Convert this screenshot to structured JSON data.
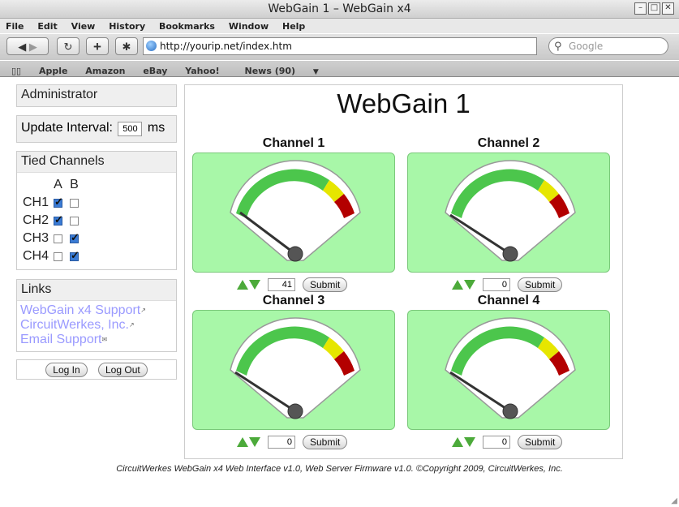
{
  "window": {
    "title": "WebGain 1 – WebGain x4"
  },
  "menu": [
    "File",
    "Edit",
    "View",
    "History",
    "Bookmarks",
    "Window",
    "Help"
  ],
  "toolbar": {
    "url": "http://yourip.net/index.htm",
    "search_placeholder": "Google"
  },
  "bookmarks": [
    "Apple",
    "Amazon",
    "eBay",
    "Yahoo!",
    "News (90)"
  ],
  "sidebar": {
    "admin_label": "Administrator",
    "interval_label": "Update Interval:",
    "interval_value": "500",
    "interval_unit": "ms",
    "tied_title": "Tied Channels",
    "col_a": "A",
    "col_b": "B",
    "tied": [
      {
        "label": "CH1",
        "a": true,
        "b": false
      },
      {
        "label": "CH2",
        "a": true,
        "b": false
      },
      {
        "label": "CH3",
        "a": false,
        "b": true
      },
      {
        "label": "CH4",
        "a": false,
        "b": true
      }
    ],
    "links_title": "Links",
    "links": [
      "WebGain x4 Support",
      "CircuitWerkes, Inc.",
      "Email Support"
    ],
    "login_label": "Log In",
    "logout_label": "Log Out"
  },
  "main": {
    "title": "WebGain 1",
    "submit_label": "Submit",
    "channels": [
      {
        "name": "Channel 1",
        "value": "41"
      },
      {
        "name": "Channel 2",
        "value": "0"
      },
      {
        "name": "Channel 3",
        "value": "0"
      },
      {
        "name": "Channel 4",
        "value": "0"
      }
    ]
  },
  "footer": "CircuitWerkes WebGain x4 Web Interface v1.0, Web Server Firmware v1.0. ©Copyright 2009, CircuitWerkes, Inc.",
  "colors": {
    "gauge_bg": "#a8f7a8",
    "gauge_green": "#4cc64c",
    "gauge_yellow": "#e6e600",
    "gauge_red": "#b30000",
    "link": "#9a9aff"
  }
}
